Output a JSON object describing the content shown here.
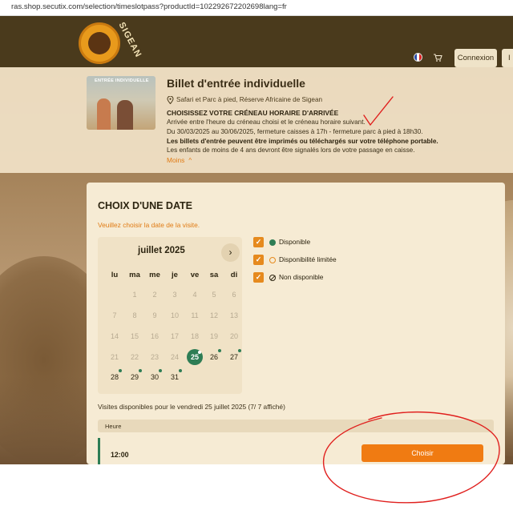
{
  "browser": {
    "url": "ras.shop.secutix.com/selection/timeslotpass?productId=102292672202698lang=fr"
  },
  "header": {
    "login_label": "Connexion",
    "extra_label": "I",
    "logo_text": "SIGEAN"
  },
  "product": {
    "thumb_label": "ENTRÉE INDIVIDUELLE",
    "title": "Billet d'entrée individuelle",
    "location": "Safari et Parc à pied, Réserve Africaine de Sigean",
    "subtitle": "CHOISISSEZ VOTRE CRÉNEAU HORAIRE D'ARRIVÉE",
    "lines": [
      "Arrivée entre l'heure du créneau choisi et le créneau horaire suivant.",
      "Du 30/03/2025 au 30/06/2025, fermeture caisses à 17h - fermeture parc à pied à 18h30.",
      "Les billets d'entrée peuvent être imprimés ou téléchargés sur votre téléphone portable.",
      "Les enfants de moins de 4 ans devront être signalés lors de votre passage en caisse."
    ],
    "less_label": "Moins"
  },
  "date_panel": {
    "title": "CHOIX D'UNE DATE",
    "hint": "Veuillez choisir la date de la visite.",
    "month": "juillet 2025",
    "weekdays": [
      "lu",
      "ma",
      "me",
      "je",
      "ve",
      "sa",
      "di"
    ],
    "days": [
      "1",
      "2",
      "3",
      "4",
      "5",
      "6",
      "7",
      "8",
      "9",
      "10",
      "11",
      "12",
      "13",
      "14",
      "15",
      "16",
      "17",
      "18",
      "19",
      "20",
      "21",
      "22",
      "23",
      "24",
      "25",
      "26",
      "27",
      "28",
      "29",
      "30",
      "31"
    ],
    "available_days": [
      "25",
      "26",
      "27",
      "28",
      "29",
      "30",
      "31"
    ],
    "selected_day": "25",
    "legend": {
      "disponible": "Disponible",
      "limitee": "Disponibilité limitée",
      "non": "Non disponible"
    },
    "visits_text": "Visites disponibles pour le vendredi 25 juillet 2025 (7/ 7 affiché)",
    "slot_header": "Heure",
    "slot_time": "12:00",
    "choose_label": "Choisir"
  },
  "colors": {
    "header_bg": "#4a3a1c",
    "accent_orange": "#f07b12",
    "available_green": "#2e7d55",
    "annotation_red": "#e0201e"
  }
}
